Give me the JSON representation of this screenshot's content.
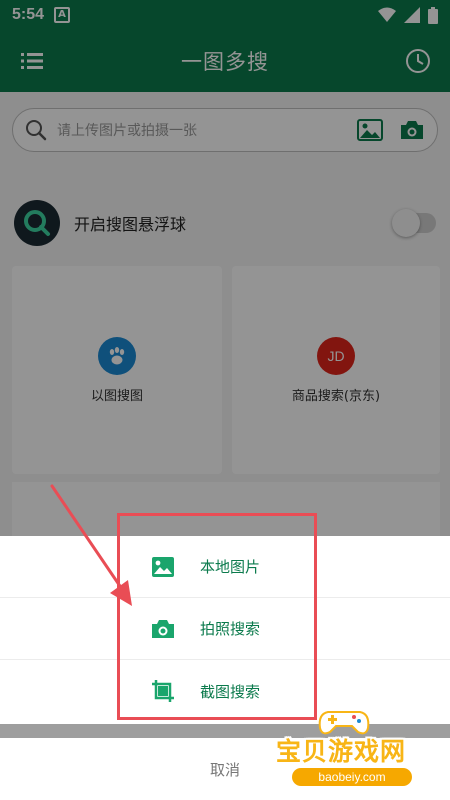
{
  "status_bar": {
    "time": "5:54",
    "badge": "A"
  },
  "header": {
    "title": "一图多搜"
  },
  "search": {
    "placeholder": "请上传图片或拍摄一张"
  },
  "floating_ball": {
    "label": "开启搜图悬浮球",
    "enabled": false
  },
  "cards": [
    {
      "label": "以图搜图",
      "icon": "baidu-paw-icon",
      "color": "#1a8ad4"
    },
    {
      "label": "商品搜索(京东)",
      "icon": "jd-logo-icon",
      "badge_text": "JD",
      "color": "#e1251b"
    }
  ],
  "sheet": {
    "options": [
      {
        "label": "本地图片",
        "icon": "image-icon"
      },
      {
        "label": "拍照搜索",
        "icon": "camera-icon"
      },
      {
        "label": "截图搜索",
        "icon": "crop-icon"
      }
    ],
    "cancel_label": "取消"
  },
  "watermark": {
    "text": "宝贝游戏网",
    "url": "baobeiy.com"
  },
  "colors": {
    "brand": "#0b7a4c",
    "annotation": "#e94d55",
    "watermark": "#f8b516"
  }
}
